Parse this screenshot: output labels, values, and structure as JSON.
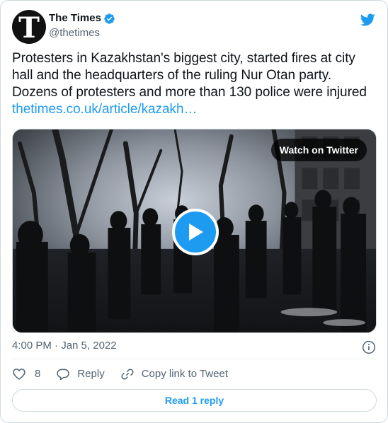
{
  "author": {
    "display_name": "The Times",
    "handle": "@thetimes",
    "avatar_letter": "T",
    "verified": true
  },
  "tweet": {
    "text": "Protesters in Kazakhstan's biggest city, started fires at city hall and the headquarters of the ruling Nur Otan party. Dozens of protesters and more than 130 police were injured ",
    "link_text": "thetimes.co.uk/article/kazakh…"
  },
  "media": {
    "watch_label": "Watch on Twitter",
    "type": "video"
  },
  "meta": {
    "timestamp": "4:00 PM · Jan 5, 2022"
  },
  "actions": {
    "like_count": "8",
    "reply_label": "Reply",
    "copy_link_label": "Copy link to Tweet"
  },
  "read_replies_label": "Read 1 reply",
  "colors": {
    "accent": "#1d9bf0",
    "secondary_text": "#536471",
    "border": "#cfd9de"
  }
}
